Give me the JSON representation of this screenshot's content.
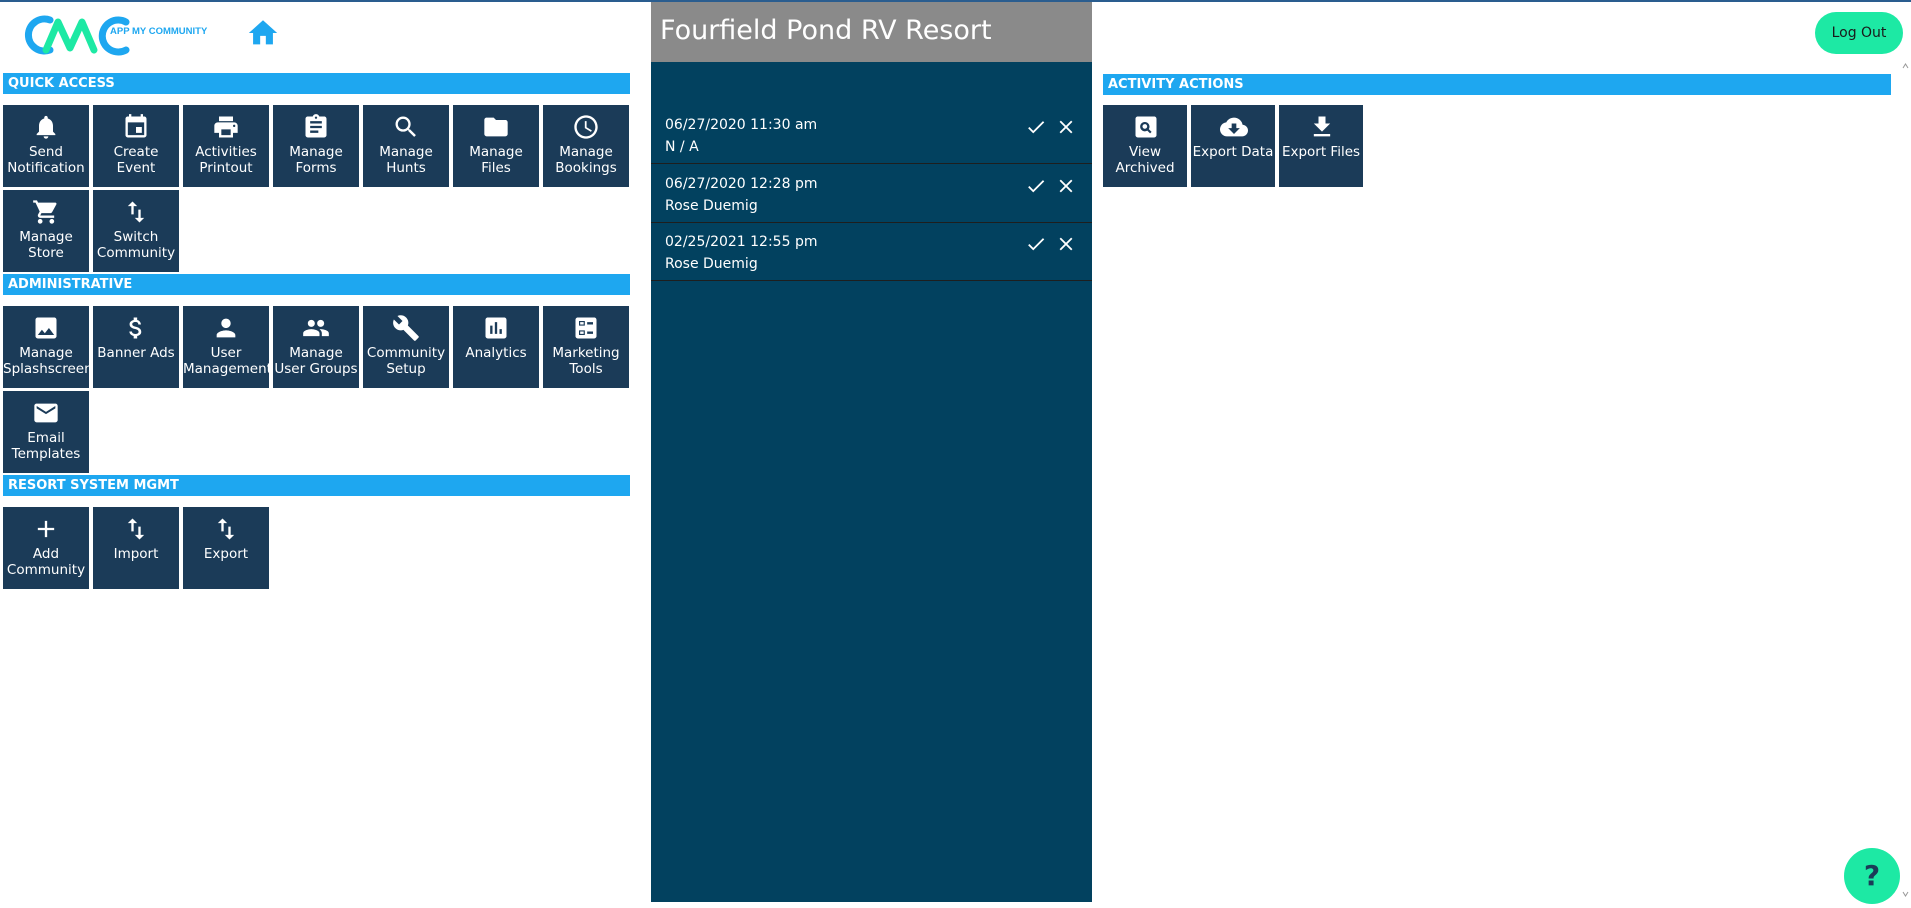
{
  "header": {
    "logo_text": "APP MY COMMUNITY",
    "logout_label": "Log Out",
    "help_label": "?"
  },
  "quick_access": {
    "title": "QUICK ACCESS",
    "items": [
      {
        "label": "Send\nNotification",
        "icon": "bell-icon"
      },
      {
        "label": "Create\nEvent",
        "icon": "calendar-icon"
      },
      {
        "label": "Activities\nPrintout",
        "icon": "printer-icon"
      },
      {
        "label": "Manage\nForms",
        "icon": "clipboard-icon"
      },
      {
        "label": "Manage\nHunts",
        "icon": "search-icon"
      },
      {
        "label": "Manage\nFiles",
        "icon": "folder-icon"
      },
      {
        "label": "Manage\nBookings",
        "icon": "clock-icon"
      },
      {
        "label": "Manage\nStore",
        "icon": "cart-icon"
      },
      {
        "label": "Switch\nCommunity",
        "icon": "swap-icon"
      }
    ]
  },
  "administrative": {
    "title": "ADMINISTRATIVE",
    "items": [
      {
        "label": "Manage\nSplashscreen",
        "icon": "image-icon"
      },
      {
        "label": "Banner Ads",
        "icon": "dollar-icon"
      },
      {
        "label": "User\nManagement",
        "icon": "person-icon"
      },
      {
        "label": "Manage\nUser Groups",
        "icon": "people-icon"
      },
      {
        "label": "Community\nSetup",
        "icon": "wrench-icon"
      },
      {
        "label": "Analytics",
        "icon": "bar-chart-icon"
      },
      {
        "label": "Marketing\nTools",
        "icon": "checklist-icon"
      },
      {
        "label": "Email\nTemplates",
        "icon": "mail-icon"
      }
    ]
  },
  "resort_system": {
    "title": "RESORT SYSTEM MGMT",
    "items": [
      {
        "label": "Add\nCommunity",
        "icon": "plus-icon"
      },
      {
        "label": "Import",
        "icon": "import-arrows-icon"
      },
      {
        "label": "Export",
        "icon": "export-arrows-icon"
      }
    ]
  },
  "middle": {
    "title": "Fourfield Pond RV Resort",
    "requests": [
      {
        "date": "06/27/2020 11:30 am",
        "name": "N / A"
      },
      {
        "date": "06/27/2020 12:28 pm",
        "name": "Rose Duemig"
      },
      {
        "date": "02/25/2021 12:55 pm",
        "name": "Rose Duemig"
      }
    ]
  },
  "activity_actions": {
    "title": "ACTIVITY ACTIONS",
    "items": [
      {
        "label": "View\nArchived",
        "icon": "archive-search-icon"
      },
      {
        "label": "Export Data",
        "icon": "cloud-download-icon"
      },
      {
        "label": "Export Files",
        "icon": "download-icon"
      }
    ]
  },
  "colors": {
    "section_bar": "#1ea7f0",
    "tile": "#1b3b58",
    "middle_panel": "#02415f",
    "title_bar": "#8a8a8a",
    "accent_green": "#1de9a4"
  }
}
